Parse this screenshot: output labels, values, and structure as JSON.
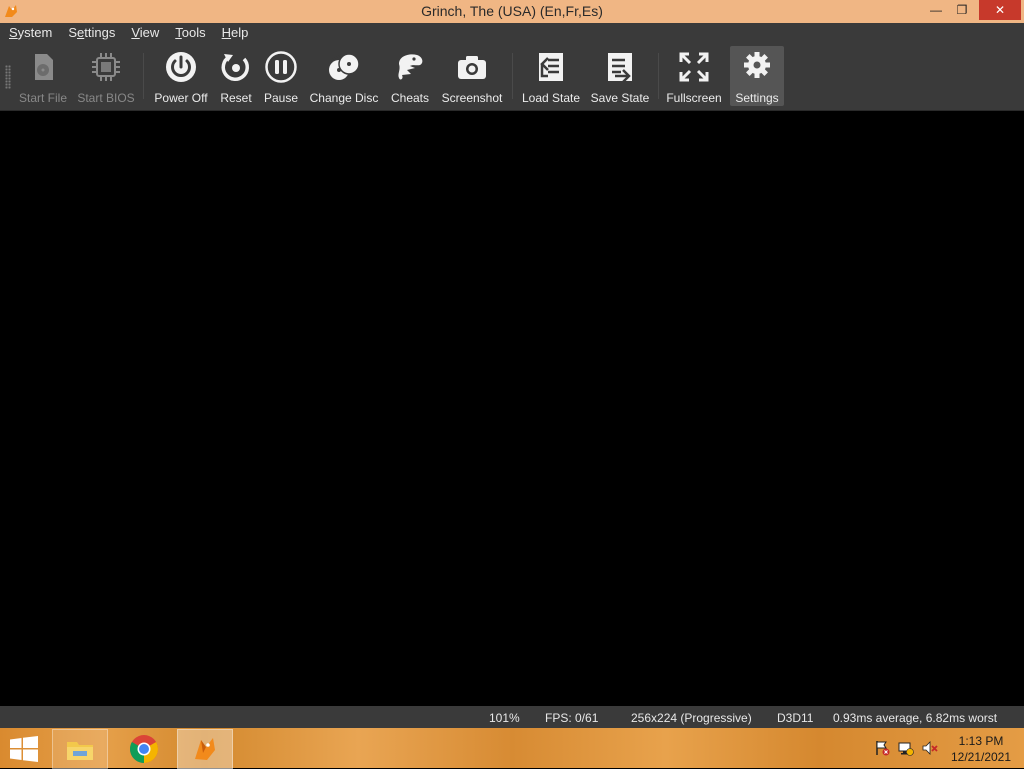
{
  "window": {
    "title": "Grinch, The (USA) (En,Fr,Es)",
    "minimize_glyph": "—",
    "maximize_glyph": "❐",
    "close_glyph": "✕"
  },
  "menu": {
    "items": [
      {
        "label": "System",
        "underline": "S"
      },
      {
        "label": "Settings",
        "underline": "e"
      },
      {
        "label": "View",
        "underline": "V"
      },
      {
        "label": "Tools",
        "underline": "T"
      },
      {
        "label": "Help",
        "underline": "H"
      }
    ]
  },
  "toolbar": {
    "buttons": [
      {
        "label": "Start File",
        "icon": "disc-file-icon",
        "enabled": false
      },
      {
        "label": "Start BIOS",
        "icon": "chip-icon",
        "enabled": false
      },
      {
        "label": "Power Off",
        "icon": "power-icon",
        "enabled": true
      },
      {
        "label": "Reset",
        "icon": "reset-icon",
        "enabled": true
      },
      {
        "label": "Pause",
        "icon": "pause-icon",
        "enabled": true
      },
      {
        "label": "Change Disc",
        "icon": "change-disc-icon",
        "enabled": true
      },
      {
        "label": "Cheats",
        "icon": "cheats-icon",
        "enabled": true
      },
      {
        "label": "Screenshot",
        "icon": "camera-icon",
        "enabled": true
      },
      {
        "label": "Load State",
        "icon": "load-state-icon",
        "enabled": true
      },
      {
        "label": "Save State",
        "icon": "save-state-icon",
        "enabled": true
      },
      {
        "label": "Fullscreen",
        "icon": "fullscreen-icon",
        "enabled": true
      },
      {
        "label": "Settings",
        "icon": "gear-icon",
        "enabled": true,
        "active": true
      }
    ]
  },
  "status": {
    "speed": "101%",
    "fps": "FPS: 0/61",
    "resolution": "256x224 (Progressive)",
    "renderer": "D3D11",
    "frame_time": "0.93ms average, 6.82ms worst"
  },
  "taskbar": {
    "apps": [
      "file-explorer-icon",
      "chrome-icon",
      "duckstation-icon"
    ],
    "clock_time": "1:13 PM",
    "clock_date": "12/21/2021"
  },
  "colors": {
    "titlebar": "#f0b684",
    "chrome": "#3a3a3a",
    "close": "#c7392b",
    "taskbar": "#e09a42"
  }
}
